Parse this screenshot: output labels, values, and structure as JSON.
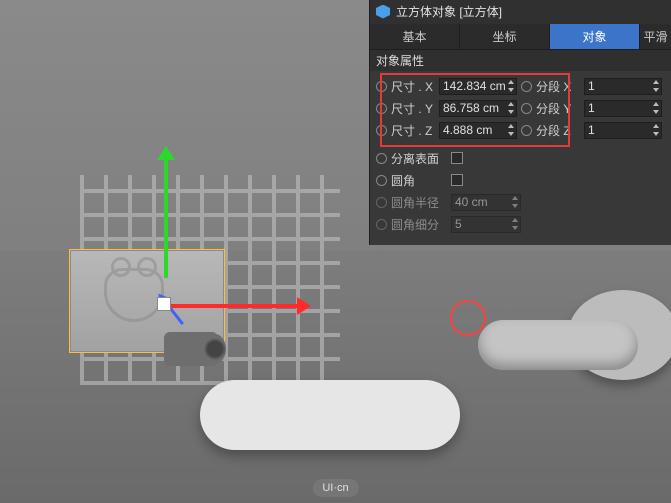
{
  "watermark": "UI·cn",
  "panel": {
    "title": "立方体对象 [立方体]",
    "tabs": {
      "basic": "基本",
      "coord": "坐标",
      "object": "对象",
      "flat": "平滑"
    },
    "group": "对象属性",
    "size": {
      "x_label": "尺寸 . X",
      "y_label": "尺寸 . Y",
      "z_label": "尺寸 . Z",
      "x_value": "142.834 cm",
      "y_value": "86.758 cm",
      "z_value": "4.888 cm"
    },
    "seg": {
      "x_label": "分段 X",
      "y_label": "分段 Y",
      "z_label": "分段 Z",
      "x_value": "1",
      "y_value": "1",
      "z_value": "1"
    },
    "separate_label": "分离表面",
    "fillet_label": "圆角",
    "fillet_radius_label": "圆角半径",
    "fillet_radius_value": "40 cm",
    "fillet_sub_label": "圆角细分",
    "fillet_sub_value": "5"
  }
}
